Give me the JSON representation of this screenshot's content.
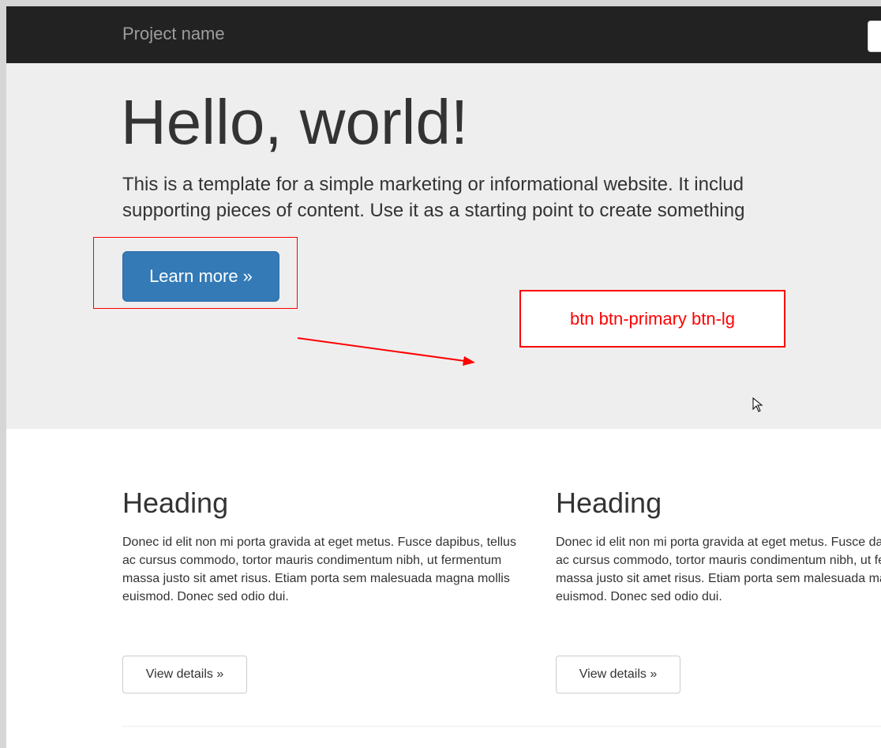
{
  "navbar": {
    "brand": "Project name"
  },
  "hero": {
    "title": "Hello, world!",
    "text_line1": "This is a template for a simple marketing or informational website. It includ",
    "text_line2": "supporting pieces of content. Use it as a starting point to create something",
    "button_label": "Learn more »"
  },
  "annotation": {
    "label": "btn btn-primary btn-lg",
    "color": "#ff0000"
  },
  "columns": [
    {
      "heading": "Heading",
      "body": "Donec id elit non mi porta gravida at eget metus. Fusce dapibus, tellus ac cursus commodo, tortor mauris condimentum nibh, ut fermentum massa justo sit amet risus. Etiam porta sem malesuada magna mollis euismod. Donec sed odio dui.",
      "button_label": "View details »"
    },
    {
      "heading": "Heading",
      "body": "Donec id elit non mi porta gravida at eget metus. Fusce dapibus, tellus ac cursus commodo, tortor mauris condimentum nibh, ut fermentum massa justo sit amet risus. Etiam porta sem malesuada magna mollis euismod. Donec sed odio dui.",
      "button_label": "View details »"
    }
  ],
  "colors": {
    "navbar_bg": "#222222",
    "jumbotron_bg": "#eeeeee",
    "primary": "#337ab7"
  }
}
